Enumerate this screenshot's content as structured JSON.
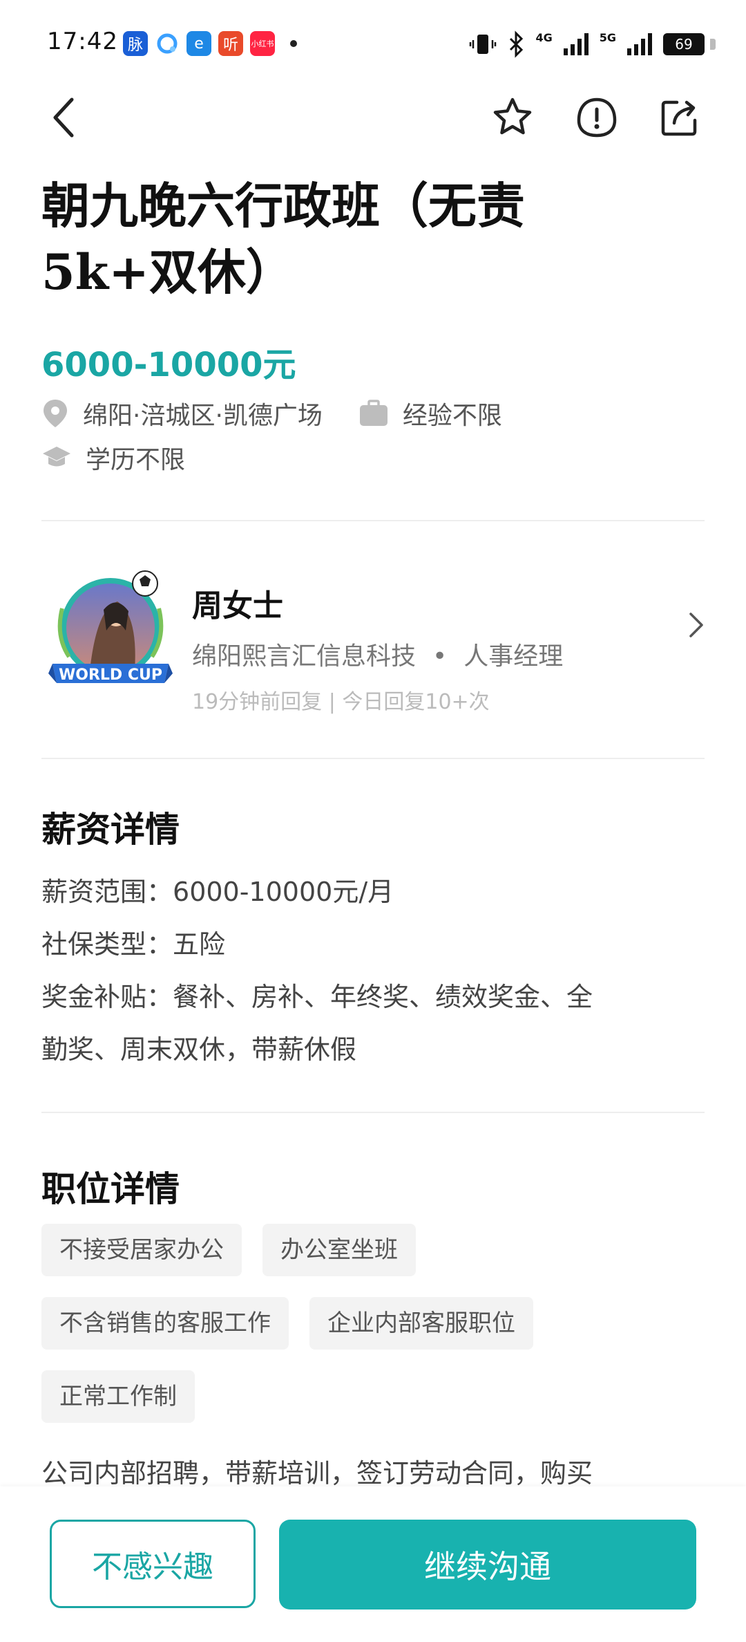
{
  "status_bar": {
    "time": "17:42",
    "apps": [
      {
        "name": "脉",
        "color": "#1a5fd6"
      },
      {
        "name": "",
        "color": "#3aa0ff"
      },
      {
        "name": "e",
        "color": "#1e88e5"
      },
      {
        "name": "听",
        "color": "#e94a2a"
      },
      {
        "name": "小红书",
        "color": "#ff2442"
      }
    ],
    "network_1": "4G",
    "network_2": "5G",
    "battery": "69"
  },
  "job": {
    "title": "朝九晚六行政班（无责5k+双休）",
    "salary": "6000-10000元",
    "location": "绵阳·涪城区·凯德广场",
    "experience": "经验不限",
    "education": "学历不限"
  },
  "recruiter": {
    "name": "周女士",
    "company": "绵阳熙言汇信息科技",
    "separator": "•",
    "role": "人事经理",
    "reply_info": "19分钟前回复 | 今日回复10+次",
    "avatar_badge": "WORLD CUP"
  },
  "salary_section": {
    "title": "薪资详情",
    "range_label": "薪资范围：",
    "range_value": "6000-10000元/月",
    "insurance_label": "社保类型：",
    "insurance_value": "五险",
    "bonus_label": "奖金补贴：",
    "bonus_line1": "餐补、房补、年终奖、绩效奖金、全",
    "bonus_line2": "勤奖、周末双休，带薪休假"
  },
  "position_section": {
    "title": "职位详情",
    "tags_row1": [
      "不接受居家办公",
      "办公室坐班"
    ],
    "tags_row2": [
      "不含销售的客服工作",
      "企业内部客服职位"
    ],
    "tags_row3": [
      "正常工作制"
    ],
    "description": "公司内部招聘，带薪培训，签订劳动合同，购买"
  },
  "actions": {
    "not_interested": "不感兴趣",
    "continue": "继续沟通"
  },
  "colors": {
    "accent": "#1aa6a4",
    "primary_button": "#18b2af"
  }
}
